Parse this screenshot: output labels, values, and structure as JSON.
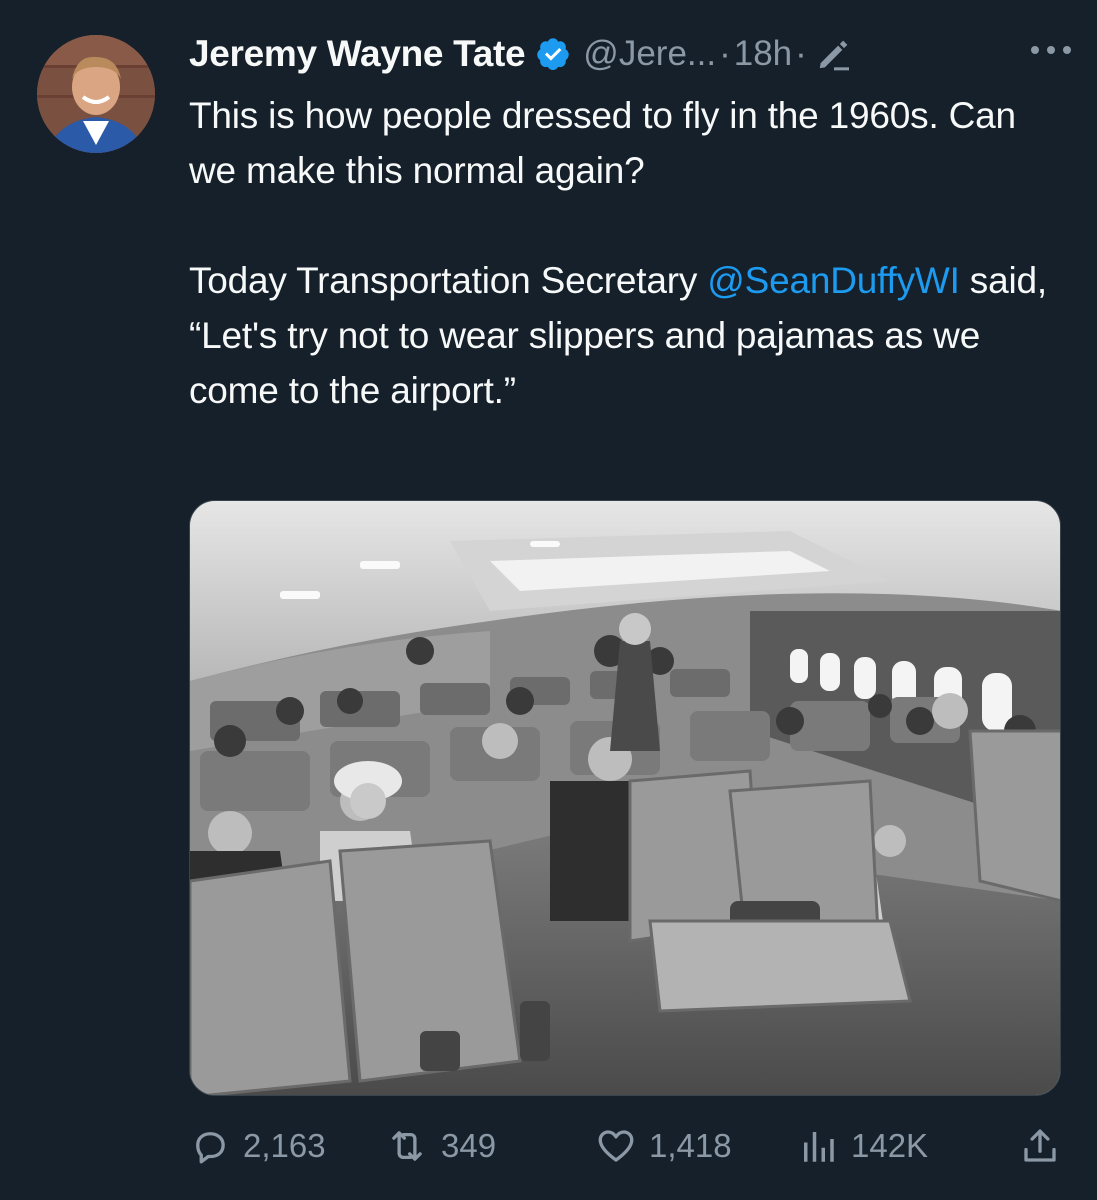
{
  "author": {
    "display_name": "Jeremy Wayne Tate",
    "handle": "@Jere...",
    "separator_1": "·",
    "time": "18h",
    "separator_2": "·",
    "verified_icon": "verified-badge-icon",
    "edit_icon": "edit-pencil-icon"
  },
  "tweet": {
    "line_1": "This is how people dressed to fly in the 1960s. Can we make this normal again?",
    "line_2_prefix": "Today Transportation Secretary ",
    "mention": "@SeanDuffyWI",
    "line_2_suffix": " said, “Let's try not to wear slippers and pajamas as we come to the airport.”"
  },
  "media": {
    "type": "photo",
    "subject": "black-and-white photo of 1960s airplane cabin passengers"
  },
  "actions": {
    "reply_count": "2,163",
    "retweet_count": "349",
    "like_count": "1,418",
    "views_count": "142K"
  },
  "colors": {
    "background": "#15202b",
    "text": "#f7f9f9",
    "muted": "#8b98a5",
    "link": "#1d9bf0",
    "verified": "#1d9bf0"
  }
}
